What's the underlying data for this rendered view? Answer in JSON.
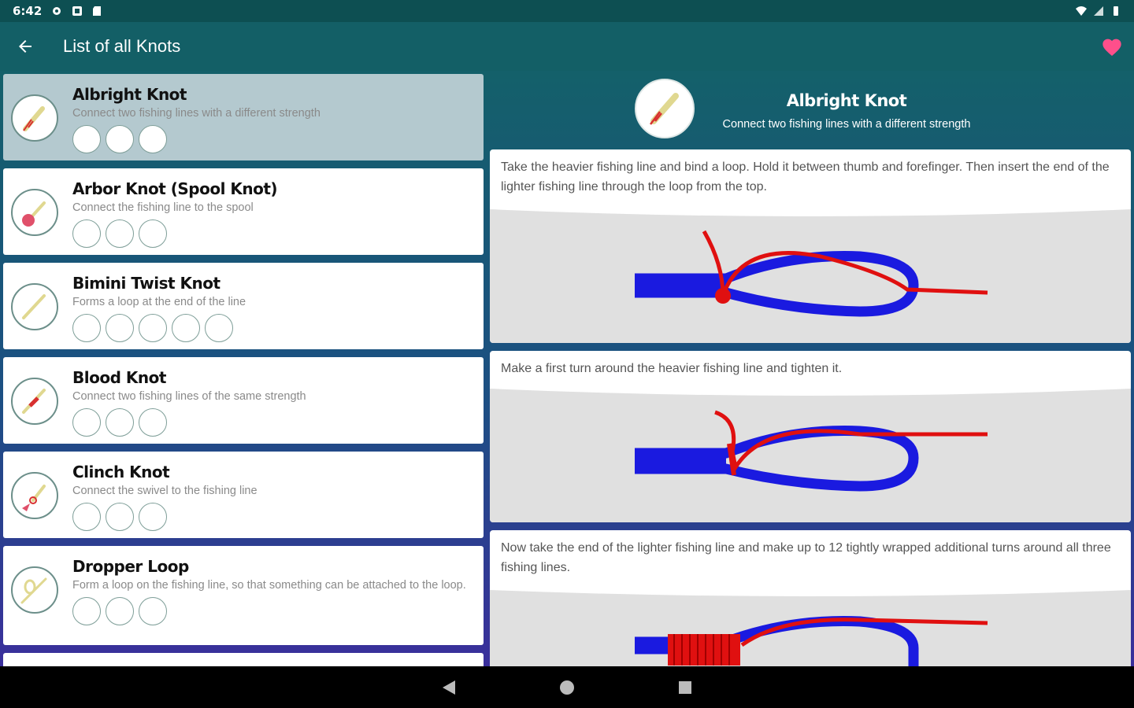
{
  "status_bar": {
    "time": "6:42"
  },
  "app_bar": {
    "title": "List of all Knots"
  },
  "knots": [
    {
      "name": "Albright Knot",
      "description": "Connect two fishing lines with a different strength",
      "steps": 3
    },
    {
      "name": "Arbor Knot (Spool Knot)",
      "description": "Connect the fishing line to the spool",
      "steps": 3
    },
    {
      "name": "Bimini Twist Knot",
      "description": "Forms a loop at the end of the line",
      "steps": 5
    },
    {
      "name": "Blood Knot",
      "description": "Connect two fishing lines of the same strength",
      "steps": 3
    },
    {
      "name": "Clinch Knot",
      "description": "Connect the swivel to the fishing line",
      "steps": 3
    },
    {
      "name": "Dropper Loop",
      "description": "Form a loop on the fishing line, so that something can be attached to the loop.",
      "steps": 3
    }
  ],
  "detail": {
    "title": "Albright Knot",
    "subtitle": "Connect two fishing lines with a different strength",
    "steps": [
      {
        "text": "Take the heavier fishing line and bind a loop. Hold it between thumb and forefinger. Then insert the end of the lighter fishing line through the loop from the top."
      },
      {
        "text": "Make a first turn around the heavier fishing line and tighten it."
      },
      {
        "text": "Now take the end of the lighter fishing line and make up to 12 tightly wrapped additional turns around all three fishing lines."
      }
    ]
  },
  "colors": {
    "app_bar": "#135f66",
    "status_bar": "#0d4f52",
    "heavy_line": "#1a1ae0",
    "light_line": "#e01010",
    "favorite": "#ff4f8b"
  }
}
